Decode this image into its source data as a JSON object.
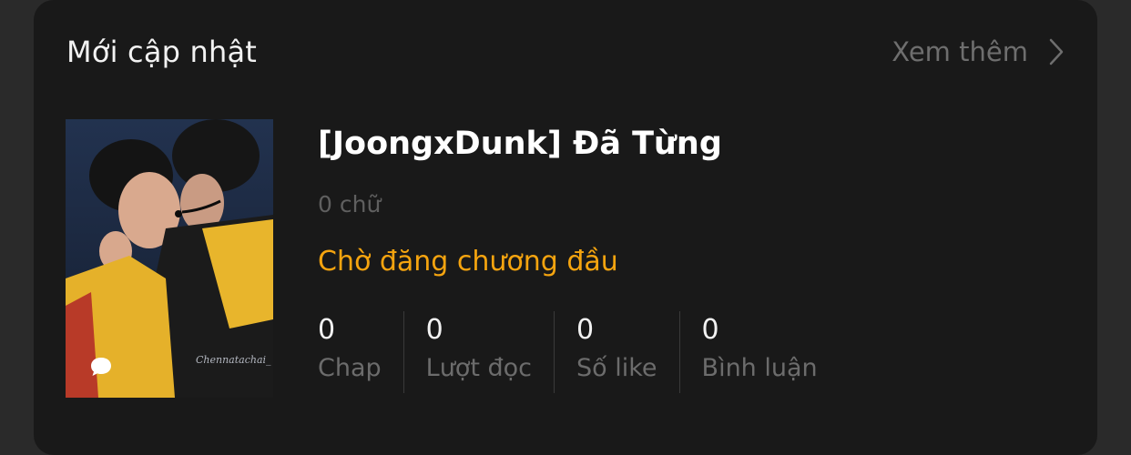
{
  "section": {
    "title": "Mới cập nhật",
    "more_label": "Xem thêm",
    "more_icon": "chevron-right-icon"
  },
  "story": {
    "title": "[JoongxDunk] Đã Từng",
    "word_count": "0 chữ",
    "status": "Chờ đăng chương đầu",
    "cover_watermark": "Chennatachai_",
    "cover_badge_icon": "chat-bubble-icon",
    "stats": [
      {
        "value": "0",
        "label": "Chap"
      },
      {
        "value": "0",
        "label": "Lượt đọc"
      },
      {
        "value": "0",
        "label": "Số like"
      },
      {
        "value": "0",
        "label": "Bình luận"
      }
    ]
  },
  "colors": {
    "page_background": "#2a2a2a",
    "card_background": "#191919",
    "status_accent": "#f5a40f",
    "muted_text": "#6c6c6c"
  }
}
